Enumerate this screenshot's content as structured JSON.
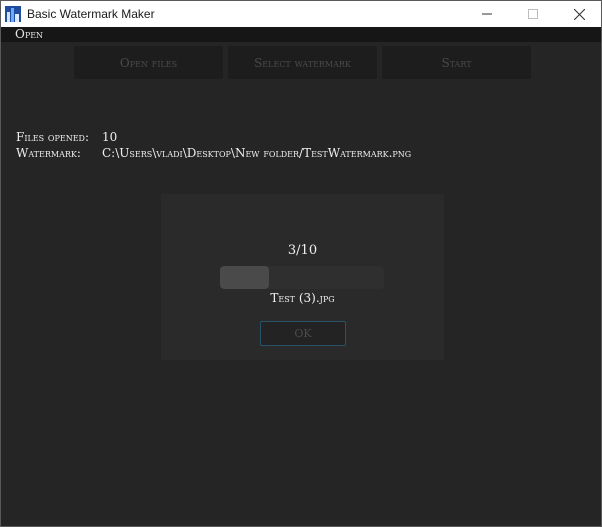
{
  "window": {
    "title": "Basic Watermark Maker"
  },
  "menubar": {
    "open_label": "Open"
  },
  "toolbar": {
    "open_files_label": "Open files",
    "select_watermark_label": "Select watermark",
    "start_label": "Start"
  },
  "info": {
    "files_opened_label": "Files opened:",
    "files_opened_value": "10",
    "watermark_label": "Watermark:",
    "watermark_value": "C:\\Users\\vladi\\Desktop\\New folder/TestWatermark.png"
  },
  "dialog": {
    "progress_text": "3/10",
    "progress_fraction": 0.3,
    "current_file": "Test (3).jpg",
    "ok_label": "OK"
  },
  "icons": {
    "app": "watermark-app-icon",
    "minimize": "minimize-icon",
    "maximize": "maximize-icon",
    "close": "close-icon"
  },
  "colors": {
    "window_bg": "#252525",
    "dialog_bg": "#2a2a2a",
    "ok_border": "#26536b",
    "progress_fill": "#4a4a4a"
  }
}
